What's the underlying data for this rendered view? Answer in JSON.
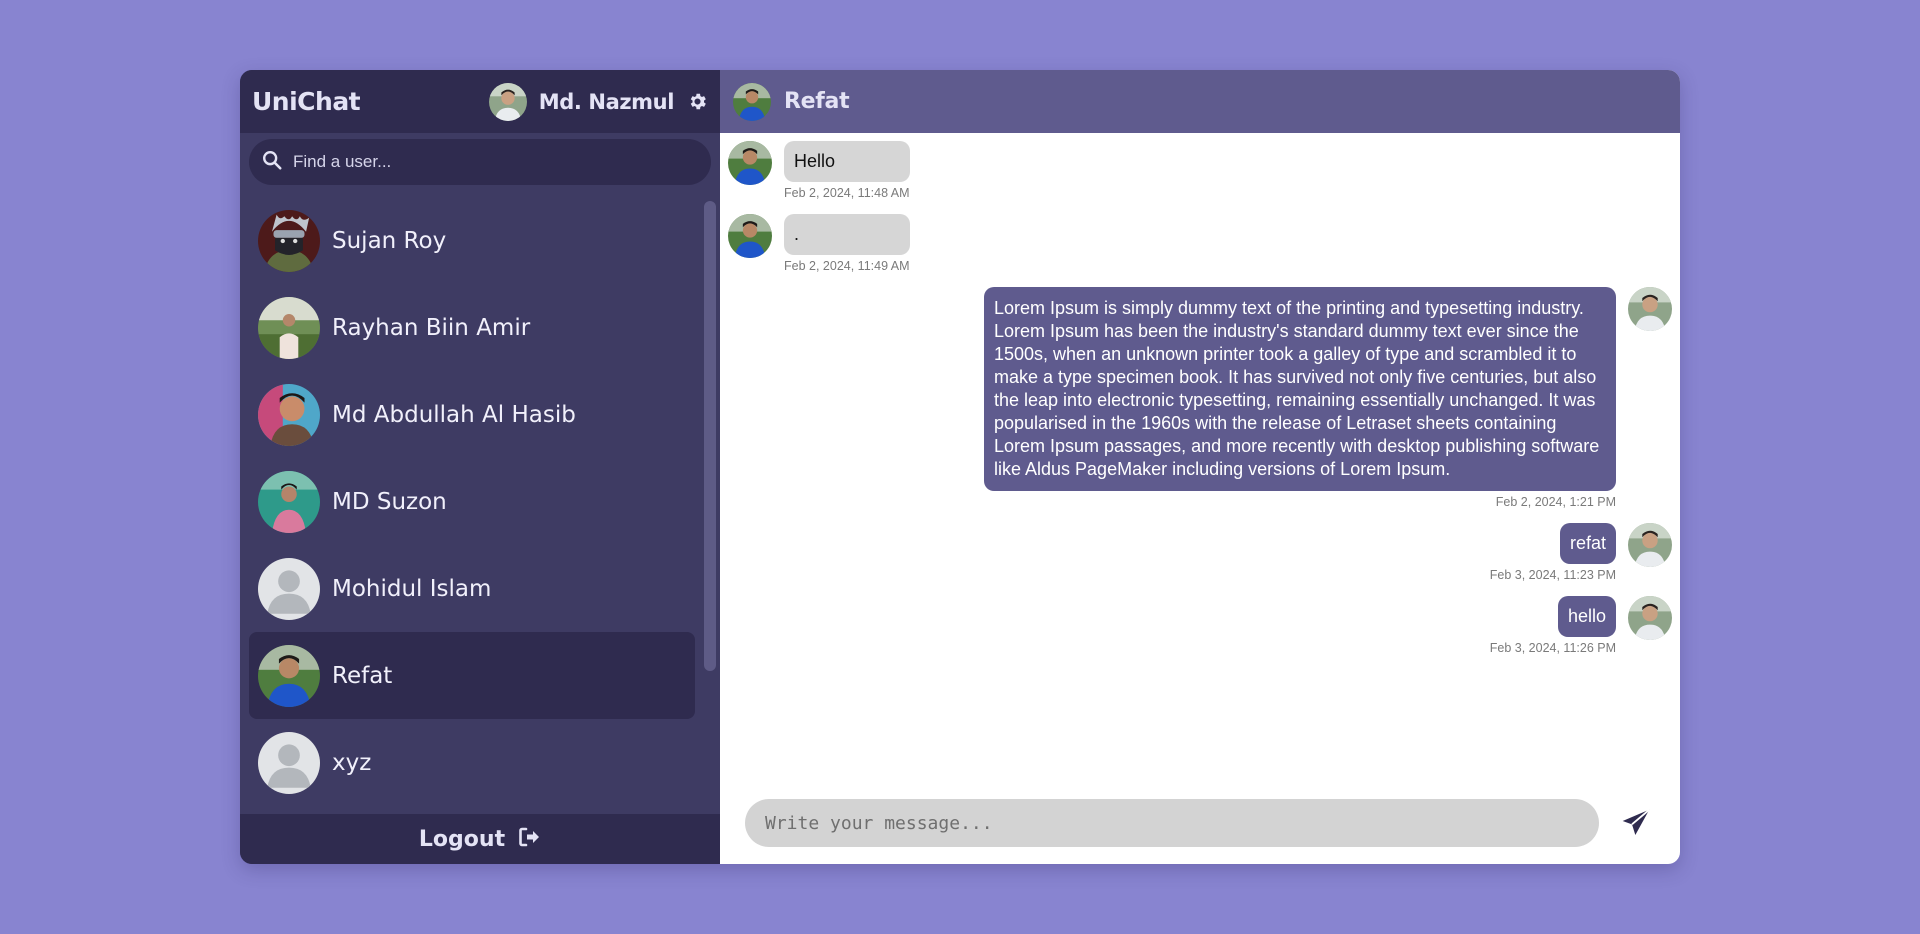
{
  "app": {
    "brand": "UniChat"
  },
  "current_user": {
    "name": "Md. Nazmul"
  },
  "search": {
    "placeholder": "Find a user..."
  },
  "users": [
    {
      "name": "Sujan Roy",
      "avatar": "ninja-avatar"
    },
    {
      "name": "Rayhan Biin Amir",
      "avatar": "photo-avatar"
    },
    {
      "name": "Md Abdullah Al Hasib",
      "avatar": "photo-avatar"
    },
    {
      "name": "MD Suzon",
      "avatar": "photo-avatar"
    },
    {
      "name": "Mohidul Islam",
      "avatar": "default-avatar"
    },
    {
      "name": "Refat",
      "avatar": "photo-avatar",
      "active": true
    },
    {
      "name": "xyz",
      "avatar": "default-avatar"
    }
  ],
  "logout": {
    "label": "Logout"
  },
  "chat": {
    "partner_name": "Refat",
    "messages": [
      {
        "direction": "in",
        "text": "Hello",
        "time": "Feb 2, 2024, 11:48 AM"
      },
      {
        "direction": "in",
        "text": ".",
        "time": "Feb 2, 2024, 11:49 AM"
      },
      {
        "direction": "out",
        "text": "Lorem Ipsum is simply dummy text of the printing and typesetting industry. Lorem Ipsum has been the industry's standard dummy text ever since the 1500s, when an unknown printer took a galley of type and scrambled it to make a type specimen book. It has survived not only five centuries, but also the leap into electronic typesetting, remaining essentially unchanged. It was popularised in the 1960s with the release of Letraset sheets containing Lorem Ipsum passages, and more recently with desktop publishing software like Aldus PageMaker including versions of Lorem Ipsum.",
        "time": "Feb 2, 2024, 1:21 PM"
      },
      {
        "direction": "out",
        "text": "refat",
        "time": "Feb 3, 2024, 11:23 PM"
      },
      {
        "direction": "out",
        "text": "hello",
        "time": "Feb 3, 2024, 11:26 PM"
      }
    ]
  },
  "composer": {
    "placeholder": "Write your message..."
  },
  "colors": {
    "background": "#8884d0",
    "sidebar": "#3e3b63",
    "sidebar_dark": "#2f2b4f",
    "chat_header": "#5f5b8e",
    "outgoing_bubble": "#5f5b8e",
    "incoming_bubble": "#d6d6d6"
  },
  "icons": {
    "search": "search-icon",
    "settings": "gear-icon",
    "logout": "logout-icon",
    "send": "send-icon"
  }
}
